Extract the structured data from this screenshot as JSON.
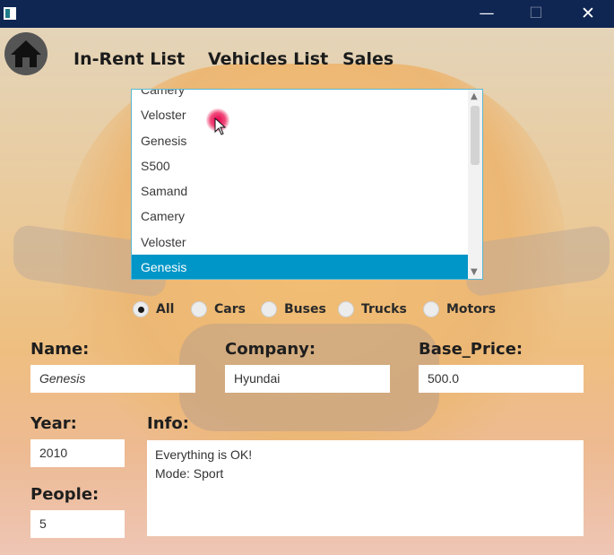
{
  "window": {
    "minimize_glyph": "—",
    "maximize_glyph": "☐",
    "close_glyph": "✕"
  },
  "nav": {
    "home_icon": "home-icon",
    "items": [
      "In-Rent List",
      "Vehicles List",
      "Sales"
    ]
  },
  "vehicle_list": {
    "items": [
      "Camery",
      "Veloster",
      "Genesis",
      "S500",
      "Samand",
      "Camery",
      "Veloster",
      "Genesis"
    ],
    "selected_index": 7
  },
  "filters": {
    "options": [
      "All",
      "Cars",
      "Buses",
      "Trucks",
      "Motors"
    ],
    "selected": "All"
  },
  "form": {
    "name_label": "Name:",
    "name_value": "Genesis",
    "company_label": "Company:",
    "company_value": "Hyundai",
    "base_price_label": "Base_Price:",
    "base_price_value": "500.0",
    "year_label": "Year:",
    "year_value": "2010",
    "info_label": "Info:",
    "info_value": "Everything is OK!\nMode: Sport",
    "people_label": "People:",
    "people_value": "5"
  },
  "colors": {
    "titlebar": "#0f2653",
    "selection": "#0096c7",
    "listbox_border": "#59b7d3"
  }
}
